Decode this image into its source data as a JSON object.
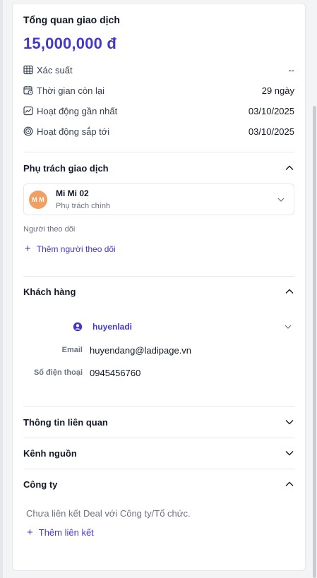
{
  "overview": {
    "title": "Tổng quan giao dịch",
    "amount": "15,000,000 đ",
    "stats": [
      {
        "icon": "table-icon",
        "label": "Xác suất",
        "value": "--"
      },
      {
        "icon": "calendar-clock-icon",
        "label": "Thời gian còn lại",
        "value": "29 ngày"
      },
      {
        "icon": "activity-chart-icon",
        "label": "Hoạt động gần nhất",
        "value": "03/10/2025"
      },
      {
        "icon": "target-icon",
        "label": "Hoạt động sắp tới",
        "value": "03/10/2025"
      }
    ]
  },
  "assignee_section": {
    "title": "Phụ trách giao dịch",
    "assignee": {
      "initials": "M M",
      "name": "Mi Mi 02",
      "role": "Phụ trách chính"
    },
    "followers_label": "Người theo dõi",
    "add_follower": "Thêm người theo dõi"
  },
  "customer_section": {
    "title": "Khách hàng",
    "customer_name": "huyenladi",
    "email_label": "Email",
    "email_value": "huyendang@ladipage.vn",
    "phone_label": "Số điện thoại",
    "phone_value": "0945456760"
  },
  "related_section": {
    "title": "Thông tin liên quan"
  },
  "source_section": {
    "title": "Kênh nguồn"
  },
  "company_section": {
    "title": "Công ty",
    "empty_note": "Chưa liên kết Deal với Công ty/Tổ chức.",
    "add_link": "Thêm liên kết"
  },
  "colors": {
    "accent": "#4338ca",
    "avatar": "#f0a062",
    "border": "#e5e7eb"
  }
}
